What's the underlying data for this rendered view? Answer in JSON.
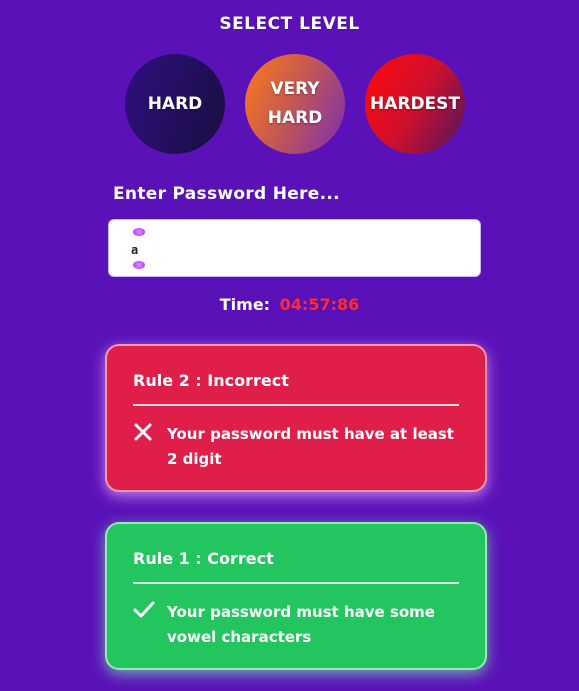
{
  "header": {
    "title": "SELECT LEVEL"
  },
  "levels": [
    {
      "label": "HARD"
    },
    {
      "label": "VERY HARD"
    },
    {
      "label": "HARDEST"
    }
  ],
  "password": {
    "label": "Enter Password Here...",
    "value": "a"
  },
  "timer": {
    "label": "Time:",
    "value": "04:57:86"
  },
  "rules": [
    {
      "title": "Rule 2 : Incorrect",
      "status": "incorrect",
      "icon": "close-icon",
      "text": "Your password must have at least 2 digit"
    },
    {
      "title": "Rule 1 : Correct",
      "status": "correct",
      "icon": "check-icon",
      "text": "Your password must have some vowel characters"
    }
  ],
  "colors": {
    "background": "#5a12b8",
    "incorrect": "#e01e4a",
    "correct": "#22c55e",
    "timer": "#ff2b2b"
  }
}
